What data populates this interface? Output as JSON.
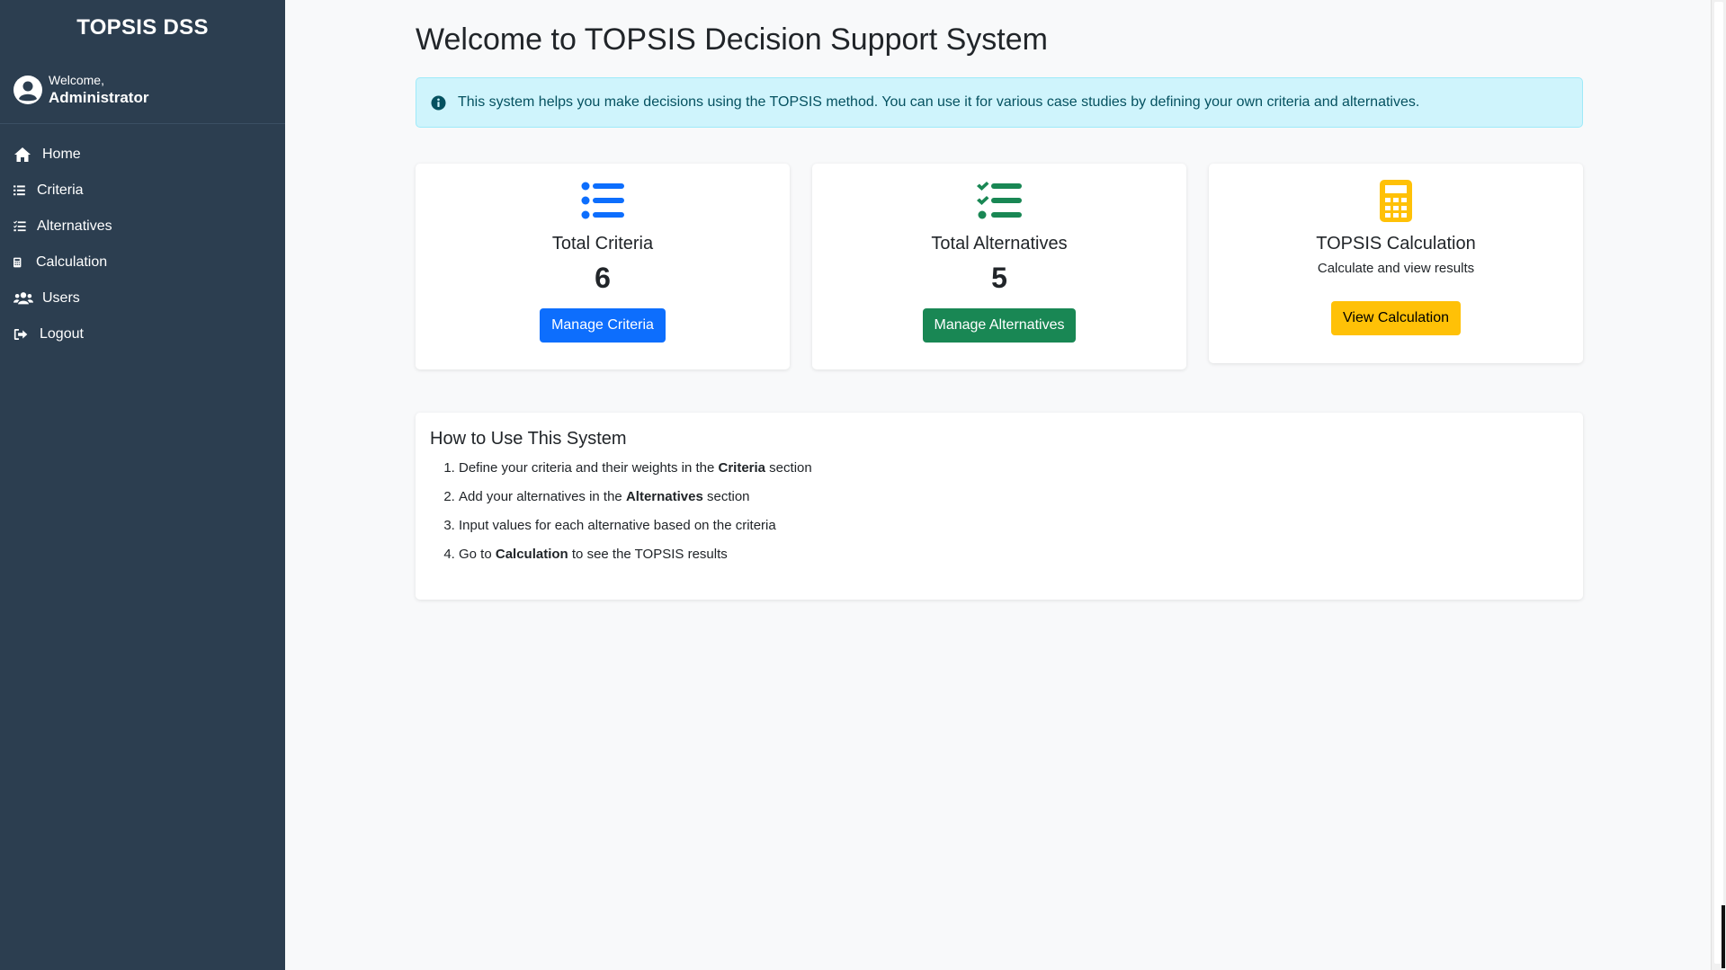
{
  "sidebar": {
    "brand": "TOPSIS DSS",
    "user": {
      "welcome": "Welcome,",
      "name": "Administrator"
    },
    "items": [
      {
        "label": "Home",
        "icon": "home-icon"
      },
      {
        "label": "Criteria",
        "icon": "list-icon"
      },
      {
        "label": "Alternatives",
        "icon": "list-check-icon"
      },
      {
        "label": "Calculation",
        "icon": "calculator-icon"
      },
      {
        "label": "Users",
        "icon": "users-icon"
      },
      {
        "label": "Logout",
        "icon": "logout-icon"
      }
    ]
  },
  "main": {
    "title": "Welcome to TOPSIS Decision Support System",
    "alert": {
      "icon": "info-circle-icon",
      "text": "This system helps you make decisions using the TOPSIS method. You can use it for various case studies by defining your own criteria and alternatives."
    },
    "cards": [
      {
        "title": "Total Criteria",
        "value": "6",
        "button": "Manage Criteria",
        "icon": "list-icon",
        "color": "#0d6efd"
      },
      {
        "title": "Total Alternatives",
        "value": "5",
        "button": "Manage Alternatives",
        "icon": "list-check-icon",
        "color": "#198754"
      },
      {
        "title": "TOPSIS Calculation",
        "subtitle": "Calculate and view results",
        "button": "View Calculation",
        "icon": "calculator-icon",
        "color": "#ffc107"
      }
    ],
    "howto": {
      "title": "How to Use This System",
      "steps": [
        {
          "before": "Define your criteria and their weights in the ",
          "bold": "Criteria",
          "after": " section"
        },
        {
          "before": "Add your alternatives in the ",
          "bold": "Alternatives",
          "after": " section"
        },
        {
          "before": "Input values for each alternative based on the criteria",
          "bold": "",
          "after": ""
        },
        {
          "before": "Go to ",
          "bold": "Calculation",
          "after": " to see the TOPSIS results"
        }
      ]
    }
  },
  "colors": {
    "sidebar_bg": "#2c3e50",
    "primary": "#0d6efd",
    "success": "#198754",
    "warning": "#ffc107",
    "info_bg": "#cff4fc"
  }
}
